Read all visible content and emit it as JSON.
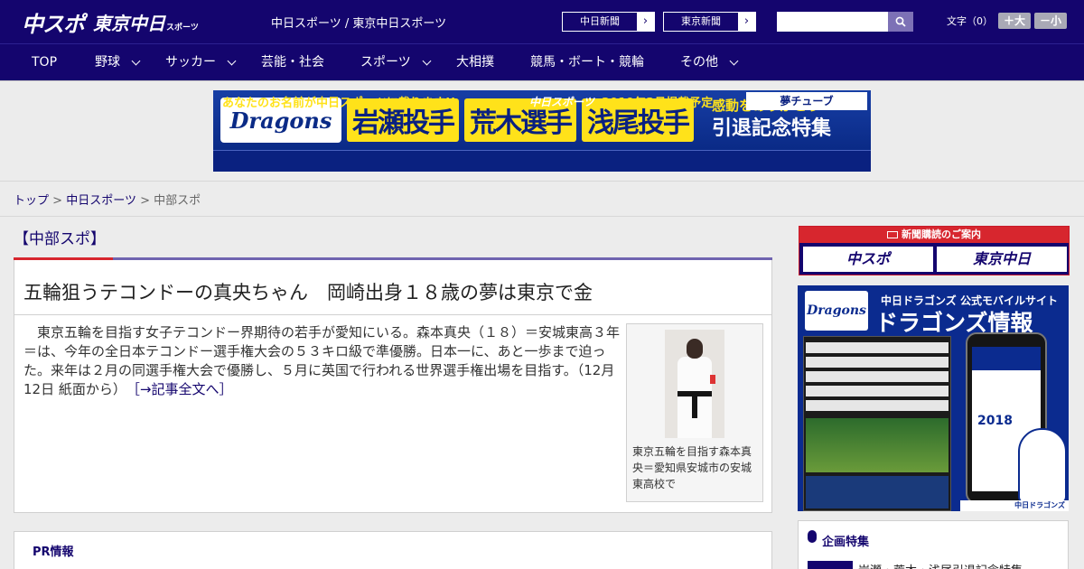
{
  "header": {
    "logo_main": "中スポ",
    "logo_sub": "東京中日",
    "logo_small": "スポーツ",
    "site_names": "中日スポーツ / 東京中日スポーツ",
    "links": [
      {
        "label": "中日新聞",
        "arrow": "›"
      },
      {
        "label": "東京新聞",
        "arrow": "›"
      }
    ],
    "search_placeholder": "",
    "font_label": "文字（0）",
    "font_bigger": "＋大",
    "font_smaller": "－小"
  },
  "nav": {
    "items": [
      {
        "label": "TOP",
        "dropdown": false
      },
      {
        "label": "野球",
        "dropdown": true
      },
      {
        "label": "サッカー",
        "dropdown": true
      },
      {
        "label": "芸能・社会",
        "dropdown": false
      },
      {
        "label": "スポーツ",
        "dropdown": true
      },
      {
        "label": "大相撲",
        "dropdown": false
      },
      {
        "label": "競馬・ボート・競輪",
        "dropdown": false
      },
      {
        "label": "その他",
        "dropdown": true
      }
    ]
  },
  "banner": {
    "brand": "Dragons",
    "names": [
      "岩瀬投手",
      "荒木選手",
      "浅尾投手"
    ],
    "message_1": "感動をありがとう",
    "message_2": "引退記念特集",
    "bottom_1": "あなたのお名前が中日スポーツに載ります!!",
    "bottom_2": "中日スポーツ",
    "bottom_3": "2019年3月掲載予定",
    "bottom_4": "夢チューブ"
  },
  "breadcrumb": {
    "home": "トップ",
    "sep": ">",
    "section": "中日スポーツ",
    "current": "中部スポ"
  },
  "section": {
    "title": "【中部スポ】"
  },
  "article": {
    "title": "五輪狙うテコンドーの真央ちゃん　岡崎出身１８歳の夢は東京で金",
    "body": "　東京五輪を目指す女子テコンドー界期待の若手が愛知にいる。森本真央（１８）＝安城東高３年＝は、今年の全日本テコンドー選手権大会の５３キロ級で準優勝。日本一に、あと一歩まで迫った。来年は２月の同選手権大会で優勝し、５月に英国で行われる世界選手権出場を目指す。（12月12日 紙面から）",
    "more_link": "［→記事全文へ］",
    "photo_caption": "東京五輪を目指す森本真央＝愛知県安城市の安城東高校で"
  },
  "pr": {
    "label": "PR情報"
  },
  "sidebar": {
    "subscribe_head": "新聞購読のご案内",
    "subscribe_1": "中スポ",
    "subscribe_2": "東京中日",
    "dragons_ad_brand": "Dragons",
    "dragons_ad_line1": "中日ドラゴンズ 公式モバイルサイト",
    "dragons_ad_line2": "ドラゴンズ情報",
    "dragons_ad_year": "2018",
    "dragons_ad_footer": "中日ドラゴンズ",
    "plan_label": "企画特集",
    "plan_item": "岩瀬・荒木・浅尾引退記念特集"
  },
  "colors": {
    "brand_navy": "#14056e",
    "accent_red": "#d7262e",
    "banner_yellow": "#ffe21a"
  }
}
